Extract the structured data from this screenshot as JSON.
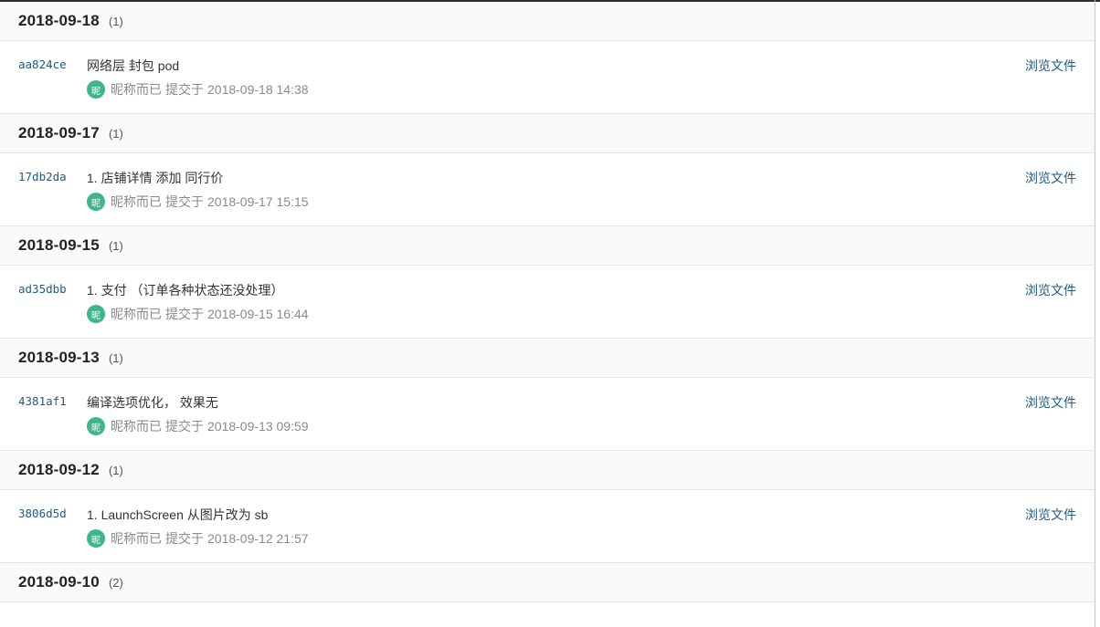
{
  "browse_label": "浏览文件",
  "author": "昵称而已",
  "avatar_char": "昵",
  "submitted_label": "提交于",
  "groups": [
    {
      "date": "2018-09-18",
      "count": "(1)",
      "commits": [
        {
          "hash": "aa824ce",
          "message": "网络层 封包 pod",
          "time": "2018-09-18 14:38"
        }
      ]
    },
    {
      "date": "2018-09-17",
      "count": "(1)",
      "commits": [
        {
          "hash": "17db2da",
          "message": "1. 店铺详情 添加 同行价",
          "time": "2018-09-17 15:15"
        }
      ]
    },
    {
      "date": "2018-09-15",
      "count": "(1)",
      "commits": [
        {
          "hash": "ad35dbb",
          "message": "1. 支付 （订单各种状态还没处理）",
          "time": "2018-09-15 16:44"
        }
      ]
    },
    {
      "date": "2018-09-13",
      "count": "(1)",
      "commits": [
        {
          "hash": "4381af1",
          "message": "编译选项优化， 效果无",
          "time": "2018-09-13 09:59"
        }
      ]
    },
    {
      "date": "2018-09-12",
      "count": "(1)",
      "commits": [
        {
          "hash": "3806d5d",
          "message": "1. LaunchScreen 从图片改为 sb",
          "time": "2018-09-12 21:57"
        }
      ]
    },
    {
      "date": "2018-09-10",
      "count": "(2)",
      "commits": []
    }
  ]
}
